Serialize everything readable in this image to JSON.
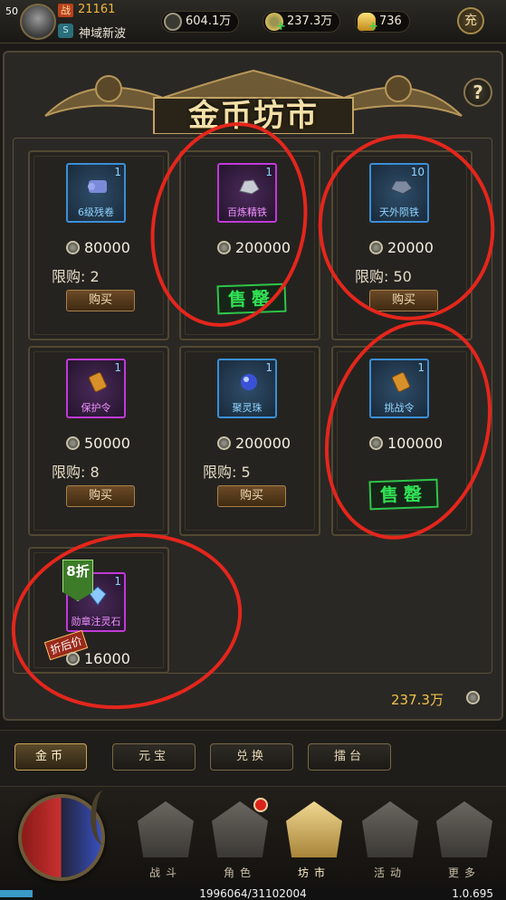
{
  "player": {
    "level": "50",
    "power_tag": "战",
    "power": "21161",
    "server_tag": "S",
    "server_name": "神域新波"
  },
  "resources": [
    {
      "name": "silver",
      "value": "604.1万"
    },
    {
      "name": "copper-coin",
      "value": "237.3万"
    },
    {
      "name": "gold-ingot",
      "value": "736"
    }
  ],
  "charge_label": "充",
  "help_label": "?",
  "title": "金币坊市",
  "items": [
    {
      "name": "6级残卷",
      "qty": "1",
      "rarity": "blue",
      "price": "80000",
      "limit_label": "限购:",
      "limit": "2",
      "status": "buy",
      "buy_label": "购买",
      "icon": "scroll-icon"
    },
    {
      "name": "百炼精铁",
      "qty": "1",
      "rarity": "purple",
      "price": "200000",
      "status": "soldout",
      "soldout_label": "售罄",
      "icon": "iron-ore-icon"
    },
    {
      "name": "天外陨铁",
      "qty": "10",
      "rarity": "blue",
      "price": "20000",
      "limit_label": "限购:",
      "limit": "50",
      "status": "buy",
      "buy_label": "购买",
      "icon": "meteor-iron-icon"
    },
    {
      "name": "保护令",
      "qty": "1",
      "rarity": "purple",
      "price": "50000",
      "limit_label": "限购:",
      "limit": "8",
      "status": "buy",
      "buy_label": "购买",
      "icon": "token-icon"
    },
    {
      "name": "聚灵珠",
      "qty": "1",
      "rarity": "blue",
      "price": "200000",
      "limit_label": "限购:",
      "limit": "5",
      "status": "buy",
      "buy_label": "购买",
      "icon": "orb-icon"
    },
    {
      "name": "挑战令",
      "qty": "1",
      "rarity": "blue",
      "price": "100000",
      "status": "soldout",
      "soldout_label": "售罄",
      "icon": "challenge-token-icon"
    },
    {
      "name": "勋章注灵石",
      "qty": "1",
      "rarity": "purple",
      "price": "16000",
      "discount": "8折",
      "after_label": "折后价",
      "icon": "crystal-icon"
    }
  ],
  "balance": "237.3万",
  "tabs": [
    "金币",
    "元宝",
    "兑换",
    "擂台"
  ],
  "nav": [
    "战斗",
    "角色",
    "坊市",
    "活动",
    "更多"
  ],
  "exp_text": "1996064/31102004",
  "exp_fraction": 0.0642,
  "version": "1.0.695"
}
